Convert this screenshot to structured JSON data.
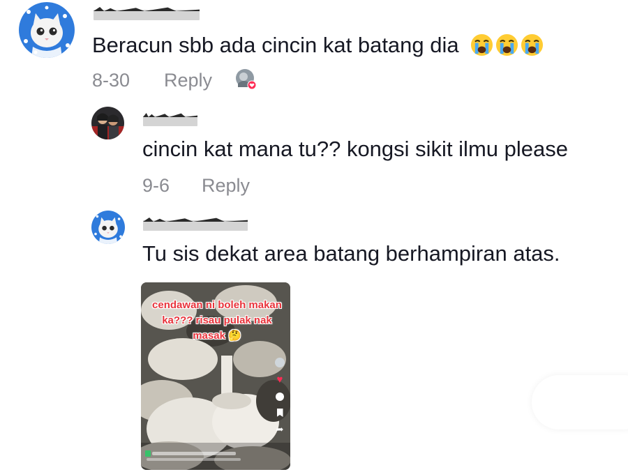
{
  "comments": [
    {
      "id": "c1",
      "text": "Beracun sbb ada cincin kat batang dia",
      "emojis": [
        "loudly-crying-face",
        "loudly-crying-face",
        "loudly-crying-face"
      ],
      "date": "8-30",
      "reply_label": "Reply",
      "liked_by_creator": true
    },
    {
      "id": "c2",
      "text": "cincin kat mana tu?? kongsi sikit ilmu please",
      "date": "9-6",
      "reply_label": "Reply"
    },
    {
      "id": "c3",
      "text": "Tu sis dekat area batang berhampiran atas.",
      "attachment": {
        "type": "video-thumbnail",
        "caption": "cendawan ni boleh makan ka??? risau pulak nak masak 🤔"
      }
    }
  ],
  "colors": {
    "text": "#161823",
    "meta": "#8a8b91",
    "caption": "#e8343c",
    "like_badge": "#fe2c55",
    "redaction": "#d4d4d4"
  }
}
